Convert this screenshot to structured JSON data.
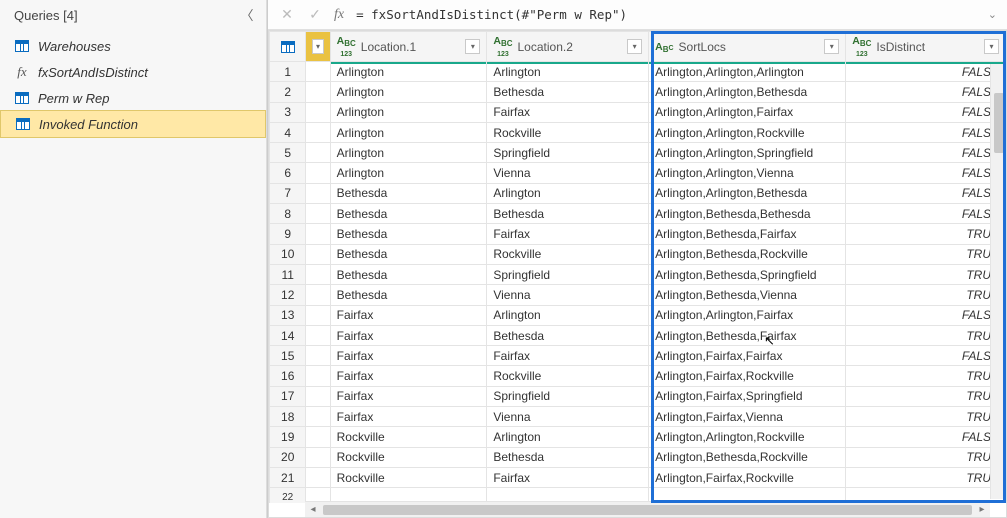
{
  "sidebar": {
    "title": "Queries [4]",
    "items": [
      {
        "label": "Warehouses",
        "icon": "table"
      },
      {
        "label": "fxSortAndIsDistinct",
        "icon": "fx"
      },
      {
        "label": "Perm w Rep",
        "icon": "table"
      },
      {
        "label": "Invoked Function",
        "icon": "table"
      }
    ]
  },
  "formula": "= fxSortAndIsDistinct(#\"Perm w Rep\")",
  "columns": {
    "loc1": "Location.1",
    "loc2": "Location.2",
    "sort": "SortLocs",
    "dist": "IsDistinct"
  },
  "rows": [
    {
      "loc1": "Arlington",
      "loc2": "Arlington",
      "sort": "Arlington,Arlington,Arlington",
      "dist": "FALSE"
    },
    {
      "loc1": "Arlington",
      "loc2": "Bethesda",
      "sort": "Arlington,Arlington,Bethesda",
      "dist": "FALSE"
    },
    {
      "loc1": "Arlington",
      "loc2": "Fairfax",
      "sort": "Arlington,Arlington,Fairfax",
      "dist": "FALSE"
    },
    {
      "loc1": "Arlington",
      "loc2": "Rockville",
      "sort": "Arlington,Arlington,Rockville",
      "dist": "FALSE"
    },
    {
      "loc1": "Arlington",
      "loc2": "Springfield",
      "sort": "Arlington,Arlington,Springfield",
      "dist": "FALSE"
    },
    {
      "loc1": "Arlington",
      "loc2": "Vienna",
      "sort": "Arlington,Arlington,Vienna",
      "dist": "FALSE"
    },
    {
      "loc1": "Bethesda",
      "loc2": "Arlington",
      "sort": "Arlington,Arlington,Bethesda",
      "dist": "FALSE"
    },
    {
      "loc1": "Bethesda",
      "loc2": "Bethesda",
      "sort": "Arlington,Bethesda,Bethesda",
      "dist": "FALSE"
    },
    {
      "loc1": "Bethesda",
      "loc2": "Fairfax",
      "sort": "Arlington,Bethesda,Fairfax",
      "dist": "TRUE"
    },
    {
      "loc1": "Bethesda",
      "loc2": "Rockville",
      "sort": "Arlington,Bethesda,Rockville",
      "dist": "TRUE"
    },
    {
      "loc1": "Bethesda",
      "loc2": "Springfield",
      "sort": "Arlington,Bethesda,Springfield",
      "dist": "TRUE"
    },
    {
      "loc1": "Bethesda",
      "loc2": "Vienna",
      "sort": "Arlington,Bethesda,Vienna",
      "dist": "TRUE"
    },
    {
      "loc1": "Fairfax",
      "loc2": "Arlington",
      "sort": "Arlington,Arlington,Fairfax",
      "dist": "FALSE"
    },
    {
      "loc1": "Fairfax",
      "loc2": "Bethesda",
      "sort": "Arlington,Bethesda,Fairfax",
      "dist": "TRUE"
    },
    {
      "loc1": "Fairfax",
      "loc2": "Fairfax",
      "sort": "Arlington,Fairfax,Fairfax",
      "dist": "FALSE"
    },
    {
      "loc1": "Fairfax",
      "loc2": "Rockville",
      "sort": "Arlington,Fairfax,Rockville",
      "dist": "TRUE"
    },
    {
      "loc1": "Fairfax",
      "loc2": "Springfield",
      "sort": "Arlington,Fairfax,Springfield",
      "dist": "TRUE"
    },
    {
      "loc1": "Fairfax",
      "loc2": "Vienna",
      "sort": "Arlington,Fairfax,Vienna",
      "dist": "TRUE"
    },
    {
      "loc1": "Rockville",
      "loc2": "Arlington",
      "sort": "Arlington,Arlington,Rockville",
      "dist": "FALSE"
    },
    {
      "loc1": "Rockville",
      "loc2": "Bethesda",
      "sort": "Arlington,Bethesda,Rockville",
      "dist": "TRUE"
    },
    {
      "loc1": "Rockville",
      "loc2": "Fairfax",
      "sort": "Arlington,Fairfax,Rockville",
      "dist": "TRUE"
    }
  ]
}
